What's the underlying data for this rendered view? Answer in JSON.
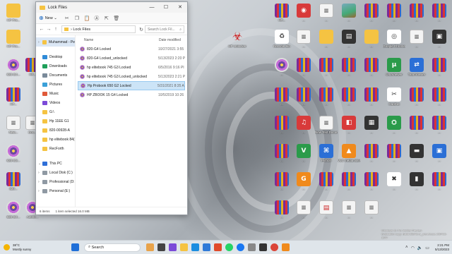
{
  "explorer": {
    "title": "Lock Files",
    "new_label": "New",
    "address": "Lock Files",
    "search_placeholder": "Search Lock Fil...",
    "columns": {
      "name": "Name",
      "date": "Date modified"
    },
    "nav_items": [
      {
        "label": "Muhammad - Pe",
        "icon": "user-folder-icon",
        "selected": true
      },
      {
        "label": "Desktop",
        "icon": "desktop-icon"
      },
      {
        "label": "Downloads",
        "icon": "downloads-icon"
      },
      {
        "label": "Documents",
        "icon": "documents-icon"
      },
      {
        "label": "Pictures",
        "icon": "pictures-icon"
      },
      {
        "label": "Music",
        "icon": "music-icon"
      },
      {
        "label": "Videos",
        "icon": "videos-icon"
      },
      {
        "label": "G:\\",
        "icon": "folder-icon"
      },
      {
        "label": "Hp 11EE G1",
        "icon": "folder-icon"
      },
      {
        "label": "820-00928-A",
        "icon": "folder-icon"
      },
      {
        "label": "hp elitebook 84(",
        "icon": "folder-icon"
      },
      {
        "label": "RecForth",
        "icon": "folder-icon"
      },
      {
        "label": "This PC",
        "icon": "this-pc-icon"
      },
      {
        "label": "Local Disk (C:)",
        "icon": "disk-icon"
      },
      {
        "label": "Professional (D:",
        "icon": "disk-icon"
      },
      {
        "label": "Personal (E:)",
        "icon": "disk-icon"
      }
    ],
    "files": [
      {
        "name": "820-G4 Locked",
        "date": "10/27/2021 3:55",
        "selected": false
      },
      {
        "name": "820-G4 Locked_unlocked",
        "date": "5/13/2023 2:20 P",
        "selected": false
      },
      {
        "name": "hp elitebook 745 G3 Locked",
        "date": "6/5/2016 9:16 PI",
        "selected": false
      },
      {
        "name": "hp elitebook 745 G3 Locked_unlocked",
        "date": "5/13/2023 2:21 P",
        "selected": false
      },
      {
        "name": "Hp Probook 650 G2 Locked",
        "date": "5/31/2021 8:35 A",
        "selected": true
      },
      {
        "name": "HP ZBOOK 15 G4 Locked",
        "date": "10/5/2019 10:26",
        "selected": false
      }
    ],
    "status": {
      "items": "6 items",
      "selection": "1 item selected  16.0 MB"
    }
  },
  "desktop_icons": [
    {
      "label": "HP Unlocker",
      "icon": "biohazard-icon",
      "color": "#cc1f1f"
    },
    {
      "label": "Recycle Bin",
      "icon": "recycle-bin-icon"
    },
    {
      "label": "Google Chrome",
      "icon": "chrome-icon"
    },
    {
      "label": "UltraViewer",
      "icon": "ultraviewer-icon"
    },
    {
      "label": "TeamViewer",
      "icon": "teamviewer-icon"
    },
    {
      "label": "CapCut",
      "icon": "capcut-icon"
    },
    {
      "label": "New Text Document",
      "icon": "text-document-icon"
    },
    {
      "label": "VLC media player",
      "icon": "vlc-icon"
    },
    {
      "label": "Python",
      "icon": "python-icon"
    }
  ],
  "taskbar": {
    "weather_temp": "38°C",
    "weather_desc": "Mostly sunny",
    "search_label": "Search",
    "time": "2:21 PM",
    "date": "5/13/2023",
    "lang": "ENG"
  },
  "watermark": {
    "line1": "Windows 11 Pro Insider Preview",
    "line2": "Evaluation copy. Build 25346.rs_prerelease.230415-1547"
  }
}
